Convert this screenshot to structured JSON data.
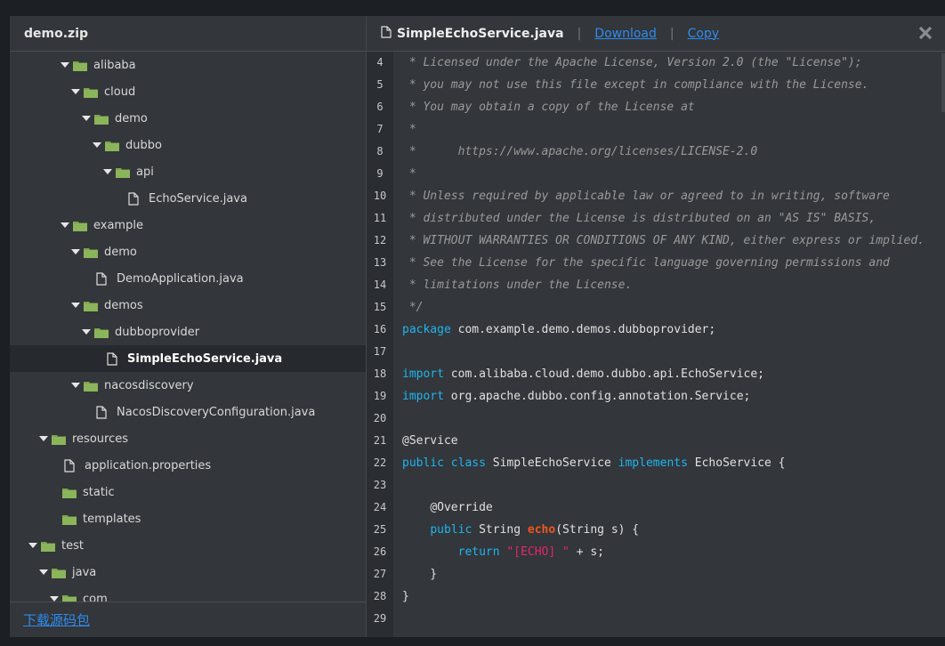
{
  "left": {
    "title": "demo.zip",
    "tree": [
      {
        "label": "alibaba",
        "type": "folder",
        "level": 4,
        "open": true
      },
      {
        "label": "cloud",
        "type": "folder",
        "level": 5,
        "open": true
      },
      {
        "label": "demo",
        "type": "folder",
        "level": 6,
        "open": true
      },
      {
        "label": "dubbo",
        "type": "folder",
        "level": 7,
        "open": true
      },
      {
        "label": "api",
        "type": "folder",
        "level": 8,
        "open": true
      },
      {
        "label": "EchoService.java",
        "type": "file",
        "level": 9
      },
      {
        "label": "example",
        "type": "folder",
        "level": 4,
        "open": true
      },
      {
        "label": "demo",
        "type": "folder",
        "level": 5,
        "open": true
      },
      {
        "label": "DemoApplication.java",
        "type": "file",
        "level": 6
      },
      {
        "label": "demos",
        "type": "folder",
        "level": 5,
        "open": true
      },
      {
        "label": "dubboprovider",
        "type": "folder",
        "level": 6,
        "open": true
      },
      {
        "label": "SimpleEchoService.java",
        "type": "file",
        "level": 7,
        "selected": true
      },
      {
        "label": "nacosdiscovery",
        "type": "folder",
        "level": 5,
        "open": true
      },
      {
        "label": "NacosDiscoveryConfiguration.java",
        "type": "file",
        "level": 6
      },
      {
        "label": "resources",
        "type": "folder",
        "level": 2,
        "open": true
      },
      {
        "label": "application.properties",
        "type": "file",
        "level": 3
      },
      {
        "label": "static",
        "type": "folder",
        "level": 3,
        "open": false
      },
      {
        "label": "templates",
        "type": "folder",
        "level": 3,
        "open": false
      },
      {
        "label": "test",
        "type": "folder",
        "level": 1,
        "open": true
      },
      {
        "label": "java",
        "type": "folder",
        "level": 2,
        "open": true
      },
      {
        "label": "com",
        "type": "folder",
        "level": 3,
        "open": true
      }
    ],
    "footer_link": "下载源码包"
  },
  "right": {
    "file_name": "SimpleEchoService.java",
    "separator": "|",
    "download_label": "Download",
    "copy_label": "Copy",
    "close_icon": "close-icon",
    "code": [
      {
        "n": "4",
        "t": [
          [
            "c",
            " * Licensed under the Apache License, Version 2.0 (the \"License\");"
          ]
        ]
      },
      {
        "n": "5",
        "t": [
          [
            "c",
            " * you may not use this file except in compliance with the License."
          ]
        ]
      },
      {
        "n": "6",
        "t": [
          [
            "c",
            " * You may obtain a copy of the License at"
          ]
        ]
      },
      {
        "n": "7",
        "t": [
          [
            "c",
            " *"
          ]
        ]
      },
      {
        "n": "8",
        "t": [
          [
            "c",
            " *      https://www.apache.org/licenses/LICENSE-2.0"
          ]
        ]
      },
      {
        "n": "9",
        "t": [
          [
            "c",
            " *"
          ]
        ]
      },
      {
        "n": "10",
        "t": [
          [
            "c",
            " * Unless required by applicable law or agreed to in writing, software"
          ]
        ]
      },
      {
        "n": "11",
        "t": [
          [
            "c",
            " * distributed under the License is distributed on an \"AS IS\" BASIS,"
          ]
        ]
      },
      {
        "n": "12",
        "t": [
          [
            "c",
            " * WITHOUT WARRANTIES OR CONDITIONS OF ANY KIND, either express or implied."
          ]
        ]
      },
      {
        "n": "13",
        "t": [
          [
            "c",
            " * See the License for the specific language governing permissions and"
          ]
        ]
      },
      {
        "n": "14",
        "t": [
          [
            "c",
            " * limitations under the License."
          ]
        ]
      },
      {
        "n": "15",
        "t": [
          [
            "c",
            " */"
          ]
        ]
      },
      {
        "n": "16",
        "t": [
          [
            "k",
            "package"
          ],
          [
            "p",
            " com.example.demo.demos.dubboprovider;"
          ]
        ]
      },
      {
        "n": "17",
        "t": []
      },
      {
        "n": "18",
        "t": [
          [
            "k",
            "import"
          ],
          [
            "p",
            " com.alibaba.cloud.demo.dubbo.api.EchoService;"
          ]
        ]
      },
      {
        "n": "19",
        "t": [
          [
            "k",
            "import"
          ],
          [
            "p",
            " org.apache.dubbo.config.annotation.Service;"
          ]
        ]
      },
      {
        "n": "20",
        "t": []
      },
      {
        "n": "21",
        "t": [
          [
            "a",
            "@Service"
          ]
        ]
      },
      {
        "n": "22",
        "t": [
          [
            "k",
            "public"
          ],
          [
            "p",
            " "
          ],
          [
            "k",
            "class"
          ],
          [
            "p",
            " SimpleEchoService "
          ],
          [
            "k",
            "implements"
          ],
          [
            "p",
            " EchoService {"
          ]
        ]
      },
      {
        "n": "23",
        "t": []
      },
      {
        "n": "24",
        "t": [
          [
            "p",
            "    "
          ],
          [
            "a",
            "@Override"
          ]
        ]
      },
      {
        "n": "25",
        "t": [
          [
            "p",
            "    "
          ],
          [
            "k",
            "public"
          ],
          [
            "p",
            " String "
          ],
          [
            "m",
            "echo"
          ],
          [
            "p",
            "(String s) {"
          ]
        ]
      },
      {
        "n": "26",
        "t": [
          [
            "p",
            "        "
          ],
          [
            "k",
            "return"
          ],
          [
            "p",
            " "
          ],
          [
            "s",
            "\"[ECHO] \""
          ],
          [
            "p",
            " + s;"
          ]
        ]
      },
      {
        "n": "27",
        "t": [
          [
            "p",
            "    }"
          ]
        ]
      },
      {
        "n": "28",
        "t": [
          [
            "p",
            "}"
          ]
        ]
      },
      {
        "n": "29",
        "t": []
      }
    ]
  },
  "colors": {
    "keyword": "#1fb5f0",
    "string": "#e5266d",
    "method": "#f0561f",
    "comment": "#9a9a9a",
    "folder": "#7ea34f",
    "link": "#2d8cf0"
  }
}
